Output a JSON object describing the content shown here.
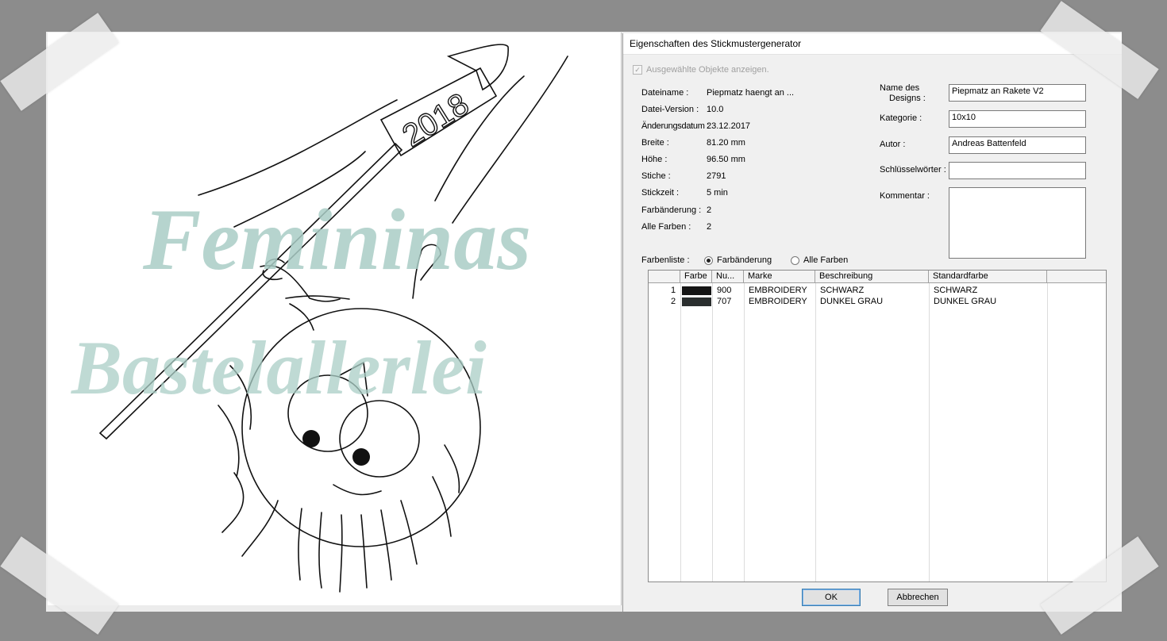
{
  "dialog": {
    "title": "Eigenschaften des Stickmustergenerator",
    "show_selected_label": "Ausgewählte Objekte anzeigen.",
    "info": [
      {
        "label": "Dateiname :",
        "value": "Piepmatz haengt an ..."
      },
      {
        "label": "Datei-Version :",
        "value": "10.0"
      },
      {
        "label": "Änderungsdatum :",
        "value": "23.12.2017"
      },
      {
        "label": "Breite :",
        "value": "81.20 mm"
      },
      {
        "label": "Höhe :",
        "value": "96.50 mm"
      },
      {
        "label": "Stiche :",
        "value": "2791"
      },
      {
        "label": "Stickzeit :",
        "value": "5 min"
      },
      {
        "label": "Farbänderung :",
        "value": "2"
      },
      {
        "label": "Alle Farben :",
        "value": "2"
      }
    ],
    "design_name_label_1": "Name des",
    "design_name_label_2": "Designs :",
    "design_name_value": "Piepmatz an Rakete V2",
    "category_label": "Kategorie :",
    "category_value": "10x10",
    "author_label": "Autor :",
    "author_value": "Andreas Battenfeld",
    "keywords_label": "Schlüsselwörter :",
    "keywords_value": "",
    "comment_label": "Kommentar :",
    "comment_value": "",
    "color_list_label": "Farbenliste :",
    "radio_color_change": "Farbänderung",
    "radio_all_colors": "Alle Farben",
    "radio_selected": "color_change",
    "table": {
      "headers": [
        "Farbe",
        "Nu...",
        "Marke",
        "Beschreibung",
        "Standardfarbe"
      ],
      "rows": [
        {
          "index": "1",
          "color": "#141414",
          "number": "900",
          "brand": "EMBROIDERY",
          "description": "SCHWARZ",
          "standard": "SCHWARZ"
        },
        {
          "index": "2",
          "color": "#2a2e2e",
          "number": "707",
          "brand": "EMBROIDERY",
          "description": "DUNKEL GRAU",
          "standard": "DUNKEL GRAU"
        }
      ]
    },
    "ok_label": "OK",
    "cancel_label": "Abbrechen"
  },
  "preview": {
    "rocket_text": "2018",
    "watermark_line_1": "Femininas",
    "watermark_line_2": "Bastelallerlei",
    "watermark_color": "#a9cdc6"
  }
}
